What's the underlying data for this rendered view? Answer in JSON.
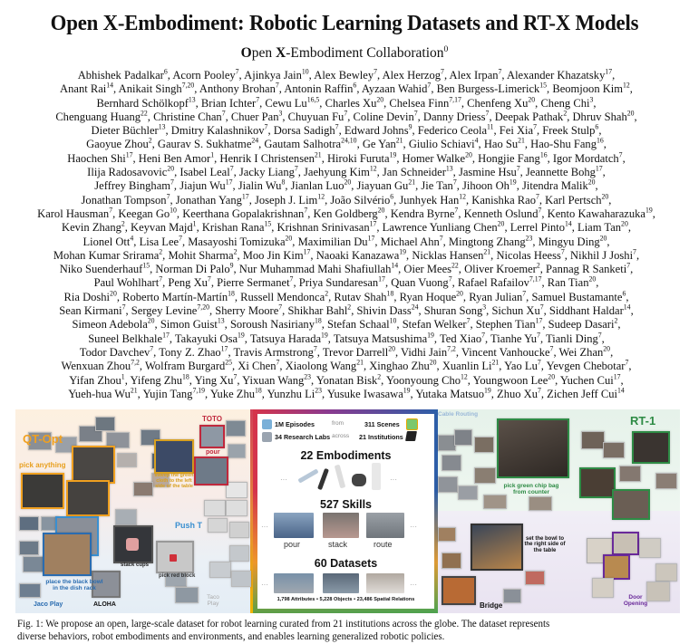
{
  "paper": {
    "title": "Open X-Embodiment: Robotic Learning Datasets and RT-X Models",
    "collaboration": {
      "o": "O",
      "pen": "pen ",
      "x": "X",
      "rest": "-Embodiment Collaboration",
      "sup": "0"
    }
  },
  "authors": [
    [
      [
        "Abhishek Padalkar",
        "6"
      ],
      [
        "Acorn Pooley",
        "7"
      ],
      [
        "Ajinkya Jain",
        "10"
      ],
      [
        "Alex Bewley",
        "7"
      ],
      [
        "Alex Herzog",
        "7"
      ],
      [
        "Alex Irpan",
        "7"
      ],
      [
        "Alexander Khazatsky",
        "17"
      ]
    ],
    [
      [
        "Anant Rai",
        "14"
      ],
      [
        "Anikait Singh",
        "7,20"
      ],
      [
        "Anthony Brohan",
        "7"
      ],
      [
        "Antonin Raffin",
        "6"
      ],
      [
        "Ayzaan Wahid",
        "7"
      ],
      [
        "Ben Burgess-Limerick",
        "15"
      ],
      [
        "Beomjoon Kim",
        "12"
      ]
    ],
    [
      [
        "Bernhard Schölkopf",
        "13"
      ],
      [
        "Brian Ichter",
        "7"
      ],
      [
        "Cewu Lu",
        "16,5"
      ],
      [
        "Charles Xu",
        "20"
      ],
      [
        "Chelsea Finn",
        "7,17"
      ],
      [
        "Chenfeng Xu",
        "20"
      ],
      [
        "Cheng Chi",
        "3"
      ]
    ],
    [
      [
        "Chenguang Huang",
        "22"
      ],
      [
        "Christine Chan",
        "7"
      ],
      [
        "Chuer Pan",
        "3"
      ],
      [
        "Chuyuan Fu",
        "7"
      ],
      [
        "Coline Devin",
        "7"
      ],
      [
        "Danny Driess",
        "7"
      ],
      [
        "Deepak Pathak",
        "2"
      ],
      [
        "Dhruv Shah",
        "20"
      ]
    ],
    [
      [
        "Dieter Büchler",
        "13"
      ],
      [
        "Dmitry Kalashnikov",
        "7"
      ],
      [
        "Dorsa Sadigh",
        "7"
      ],
      [
        "Edward Johns",
        "9"
      ],
      [
        "Federico Ceola",
        "11"
      ],
      [
        "Fei Xia",
        "7"
      ],
      [
        "Freek Stulp",
        "6"
      ]
    ],
    [
      [
        "Gaoyue Zhou",
        "2"
      ],
      [
        "Gaurav S. Sukhatme",
        "24"
      ],
      [
        "Gautam Salhotra",
        "24,10"
      ],
      [
        "Ge Yan",
        "21"
      ],
      [
        "Giulio Schiavi",
        "4"
      ],
      [
        "Hao Su",
        "21"
      ],
      [
        "Hao-Shu Fang",
        "16"
      ]
    ],
    [
      [
        "Haochen Shi",
        "17"
      ],
      [
        "Heni Ben Amor",
        "1"
      ],
      [
        "Henrik I Christensen",
        "21"
      ],
      [
        "Hiroki Furuta",
        "19"
      ],
      [
        "Homer Walke",
        "20"
      ],
      [
        "Hongjie Fang",
        "16"
      ],
      [
        "Igor Mordatch",
        "7"
      ]
    ],
    [
      [
        "Ilija Radosavovic",
        "20"
      ],
      [
        "Isabel Leal",
        "7"
      ],
      [
        "Jacky Liang",
        "7"
      ],
      [
        "Jaehyung Kim",
        "12"
      ],
      [
        "Jan Schneider",
        "13"
      ],
      [
        "Jasmine Hsu",
        "7"
      ],
      [
        "Jeannette Bohg",
        "17"
      ]
    ],
    [
      [
        "Jeffrey Bingham",
        "7"
      ],
      [
        "Jiajun Wu",
        "17"
      ],
      [
        "Jialin Wu",
        "8"
      ],
      [
        "Jianlan Luo",
        "20"
      ],
      [
        "Jiayuan Gu",
        "21"
      ],
      [
        "Jie Tan",
        "7"
      ],
      [
        "Jihoon Oh",
        "19"
      ],
      [
        "Jitendra Malik",
        "20"
      ]
    ],
    [
      [
        "Jonathan Tompson",
        "7"
      ],
      [
        "Jonathan Yang",
        "17"
      ],
      [
        "Joseph J. Lim",
        "12"
      ],
      [
        "João Silvério",
        "6"
      ],
      [
        "Junhyek Han",
        "12"
      ],
      [
        "Kanishka Rao",
        "7"
      ],
      [
        "Karl Pertsch",
        "20"
      ]
    ],
    [
      [
        "Karol Hausman",
        "7"
      ],
      [
        "Keegan Go",
        "10"
      ],
      [
        "Keerthana Gopalakrishnan",
        "7"
      ],
      [
        "Ken Goldberg",
        "20"
      ],
      [
        "Kendra Byrne",
        "7"
      ],
      [
        "Kenneth Oslund",
        "7"
      ],
      [
        "Kento Kawaharazuka",
        "19"
      ]
    ],
    [
      [
        "Kevin Zhang",
        "2"
      ],
      [
        "Keyvan Majd",
        "1"
      ],
      [
        "Krishan Rana",
        "15"
      ],
      [
        "Krishnan Srinivasan",
        "17"
      ],
      [
        "Lawrence Yunliang Chen",
        "20"
      ],
      [
        "Lerrel Pinto",
        "14"
      ],
      [
        "Liam Tan",
        "20"
      ]
    ],
    [
      [
        "Lionel Ott",
        "4"
      ],
      [
        "Lisa Lee",
        "7"
      ],
      [
        "Masayoshi Tomizuka",
        "20"
      ],
      [
        "Maximilian Du",
        "17"
      ],
      [
        "Michael Ahn",
        "7"
      ],
      [
        "Mingtong Zhang",
        "23"
      ],
      [
        "Mingyu Ding",
        "20"
      ]
    ],
    [
      [
        "Mohan Kumar Srirama",
        "2"
      ],
      [
        "Mohit Sharma",
        "2"
      ],
      [
        "Moo Jin Kim",
        "17"
      ],
      [
        "Naoaki Kanazawa",
        "19"
      ],
      [
        "Nicklas Hansen",
        "21"
      ],
      [
        "Nicolas Heess",
        "7"
      ],
      [
        "Nikhil J Joshi",
        "7"
      ]
    ],
    [
      [
        "Niko Suenderhauf",
        "15"
      ],
      [
        "Norman Di Palo",
        "9"
      ],
      [
        "Nur Muhammad Mahi Shafiullah",
        "14"
      ],
      [
        "Oier Mees",
        "22"
      ],
      [
        "Oliver Kroemer",
        "2"
      ],
      [
        "Pannag R Sanketi",
        "7"
      ]
    ],
    [
      [
        "Paul Wohlhart",
        "7"
      ],
      [
        "Peng Xu",
        "7"
      ],
      [
        "Pierre Sermanet",
        "7"
      ],
      [
        "Priya Sundaresan",
        "17"
      ],
      [
        "Quan Vuong",
        "7"
      ],
      [
        "Rafael Rafailov",
        "7,17"
      ],
      [
        "Ran Tian",
        "20"
      ]
    ],
    [
      [
        "Ria Doshi",
        "20"
      ],
      [
        "Roberto Martín-Martín",
        "18"
      ],
      [
        "Russell Mendonca",
        "2"
      ],
      [
        "Rutav Shah",
        "18"
      ],
      [
        "Ryan Hoque",
        "20"
      ],
      [
        "Ryan Julian",
        "7"
      ],
      [
        "Samuel Bustamante",
        "6"
      ]
    ],
    [
      [
        "Sean Kirmani",
        "7"
      ],
      [
        "Sergey Levine",
        "7,20"
      ],
      [
        "Sherry Moore",
        "7"
      ],
      [
        "Shikhar Bahl",
        "2"
      ],
      [
        "Shivin Dass",
        "24"
      ],
      [
        "Shuran Song",
        "3"
      ],
      [
        "Sichun Xu",
        "7"
      ],
      [
        "Siddhant Haldar",
        "14"
      ]
    ],
    [
      [
        "Simeon Adebola",
        "20"
      ],
      [
        "Simon Guist",
        "13"
      ],
      [
        "Soroush Nasiriany",
        "18"
      ],
      [
        "Stefan Schaal",
        "10"
      ],
      [
        "Stefan Welker",
        "7"
      ],
      [
        "Stephen Tian",
        "17"
      ],
      [
        "Sudeep Dasari",
        "2"
      ]
    ],
    [
      [
        "Suneel Belkhale",
        "17"
      ],
      [
        "Takayuki Osa",
        "19"
      ],
      [
        "Tatsuya Harada",
        "19"
      ],
      [
        "Tatsuya Matsushima",
        "19"
      ],
      [
        "Ted Xiao",
        "7"
      ],
      [
        "Tianhe Yu",
        "7"
      ],
      [
        "Tianli Ding",
        "7"
      ]
    ],
    [
      [
        "Todor Davchev",
        "7"
      ],
      [
        "Tony Z. Zhao",
        "17"
      ],
      [
        "Travis Armstrong",
        "7"
      ],
      [
        "Trevor Darrell",
        "20"
      ],
      [
        "Vidhi Jain",
        "7,2"
      ],
      [
        "Vincent Vanhoucke",
        "7"
      ],
      [
        "Wei Zhan",
        "20"
      ]
    ],
    [
      [
        "Wenxuan Zhou",
        "7,2"
      ],
      [
        "Wolfram Burgard",
        "25"
      ],
      [
        "Xi Chen",
        "7"
      ],
      [
        "Xiaolong Wang",
        "21"
      ],
      [
        "Xinghao Zhu",
        "20"
      ],
      [
        "Xuanlin Li",
        "21"
      ],
      [
        "Yao Lu",
        "7"
      ],
      [
        "Yevgen Chebotar",
        "7"
      ]
    ],
    [
      [
        "Yifan Zhou",
        "1"
      ],
      [
        "Yifeng Zhu",
        "18"
      ],
      [
        "Ying Xu",
        "7"
      ],
      [
        "Yixuan Wang",
        "23"
      ],
      [
        "Yonatan Bisk",
        "2"
      ],
      [
        "Yoonyoung Cho",
        "12"
      ],
      [
        "Youngwoon Lee",
        "20"
      ],
      [
        "Yuchen Cui",
        "17"
      ]
    ],
    [
      [
        "Yueh-hua Wu",
        "21"
      ],
      [
        "Yujin Tang",
        "7,19"
      ],
      [
        "Yuke Zhu",
        "18"
      ],
      [
        "Yunzhu Li",
        "23"
      ],
      [
        "Yusuke Iwasawa",
        "19"
      ],
      [
        "Yutaka Matsuo",
        "19"
      ],
      [
        "Zhuo Xu",
        "7"
      ],
      [
        "Zichen Jeff Cui",
        "14"
      ]
    ]
  ],
  "figure": {
    "left_labels": {
      "qt_opt": "QT-Opt",
      "pick_anything": "pick anything",
      "toto": "TOTO",
      "pour": "pour",
      "sweep": "sweep the green cloth to the left side of the table",
      "push_t": "Push T",
      "stack_cups": "stack cups",
      "pick_red_block": "pick red block",
      "place_bowl": "place the black bowl in the dish rack",
      "jaco_play": "Jaco Play",
      "aloha": "ALOHA",
      "taco_play": "Taco Play"
    },
    "center": {
      "episodes": "1M Episodes",
      "from": "from",
      "scenes": "311 Scenes",
      "labs": "34 Research Labs",
      "across": "across",
      "institutions": "21 Institutions",
      "embodiments": "22 Embodiments",
      "skills": "527 Skills",
      "skill_examples": [
        "pour",
        "stack",
        "route"
      ],
      "datasets": "60 Datasets",
      "ellipsis": "···",
      "footer": "1,798 Attributes  •  5,228 Objects  •  23,486 Spatial Relations"
    },
    "right_labels": {
      "cable_routing": "Cable Routing",
      "rt1": "RT-1",
      "pick_chip": "pick green chip bag from counter",
      "set_bowl": "set the bowl to the right side of the table",
      "bridge": "Bridge",
      "door_opening": "Door Opening"
    },
    "colors": {
      "qt_opt": "#f0a020",
      "toto": "#c0283c",
      "push_t": "#3a8fd0",
      "jaco": "#2a6cb0",
      "rt1": "#2e8b45",
      "door": "#6a2a9a",
      "cable": "#9ab8d8",
      "sweep": "#d8a020"
    }
  },
  "caption": {
    "line1": "Fig. 1: We propose an open, large-scale dataset for robot learning curated from 21 institutions across the globe. The dataset represents",
    "line2": "diverse behaviors, robot embodiments and environments, and enables learning generalized robotic policies."
  }
}
